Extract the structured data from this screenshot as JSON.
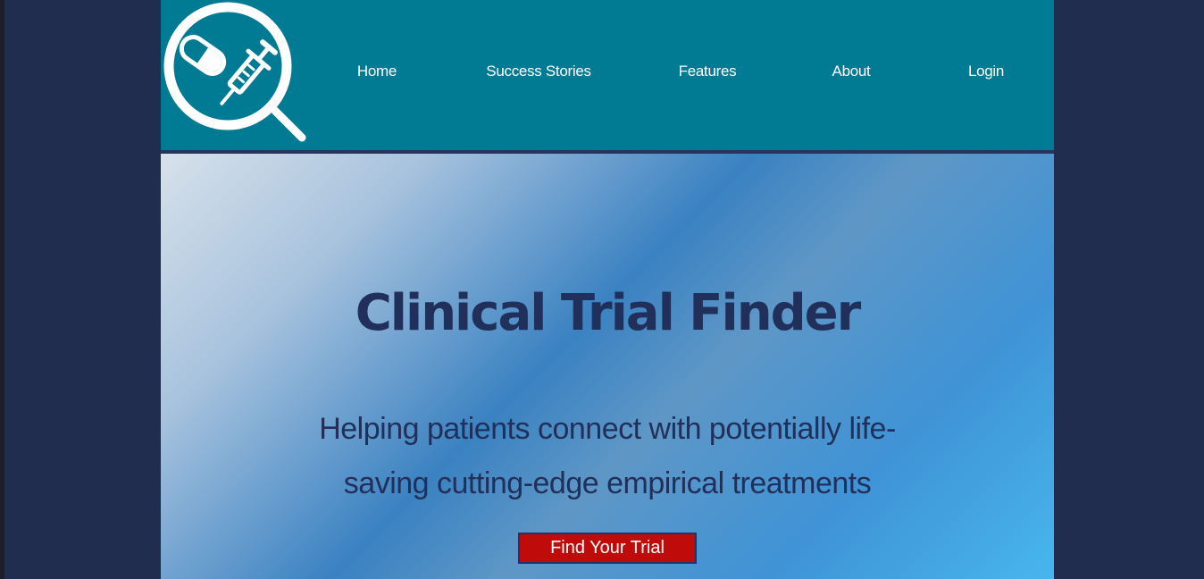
{
  "header": {
    "logo_icon": "magnifier-pill-syringe-icon",
    "nav": [
      {
        "label": "Home"
      },
      {
        "label": "Success Stories"
      },
      {
        "label": "Features"
      },
      {
        "label": "About"
      },
      {
        "label": "Login"
      }
    ]
  },
  "hero": {
    "title": "Clinical Trial Finder",
    "subtitle": "Helping patients connect with potentially life-saving cutting-edge empirical treatments",
    "cta_label": "Find Your Trial"
  },
  "colors": {
    "page_background": "#212d4f",
    "header_background": "#017a93",
    "header_border": "#25355e",
    "title_text": "#21305a",
    "cta_background": "#c00b0b",
    "cta_border": "#1f3567"
  }
}
